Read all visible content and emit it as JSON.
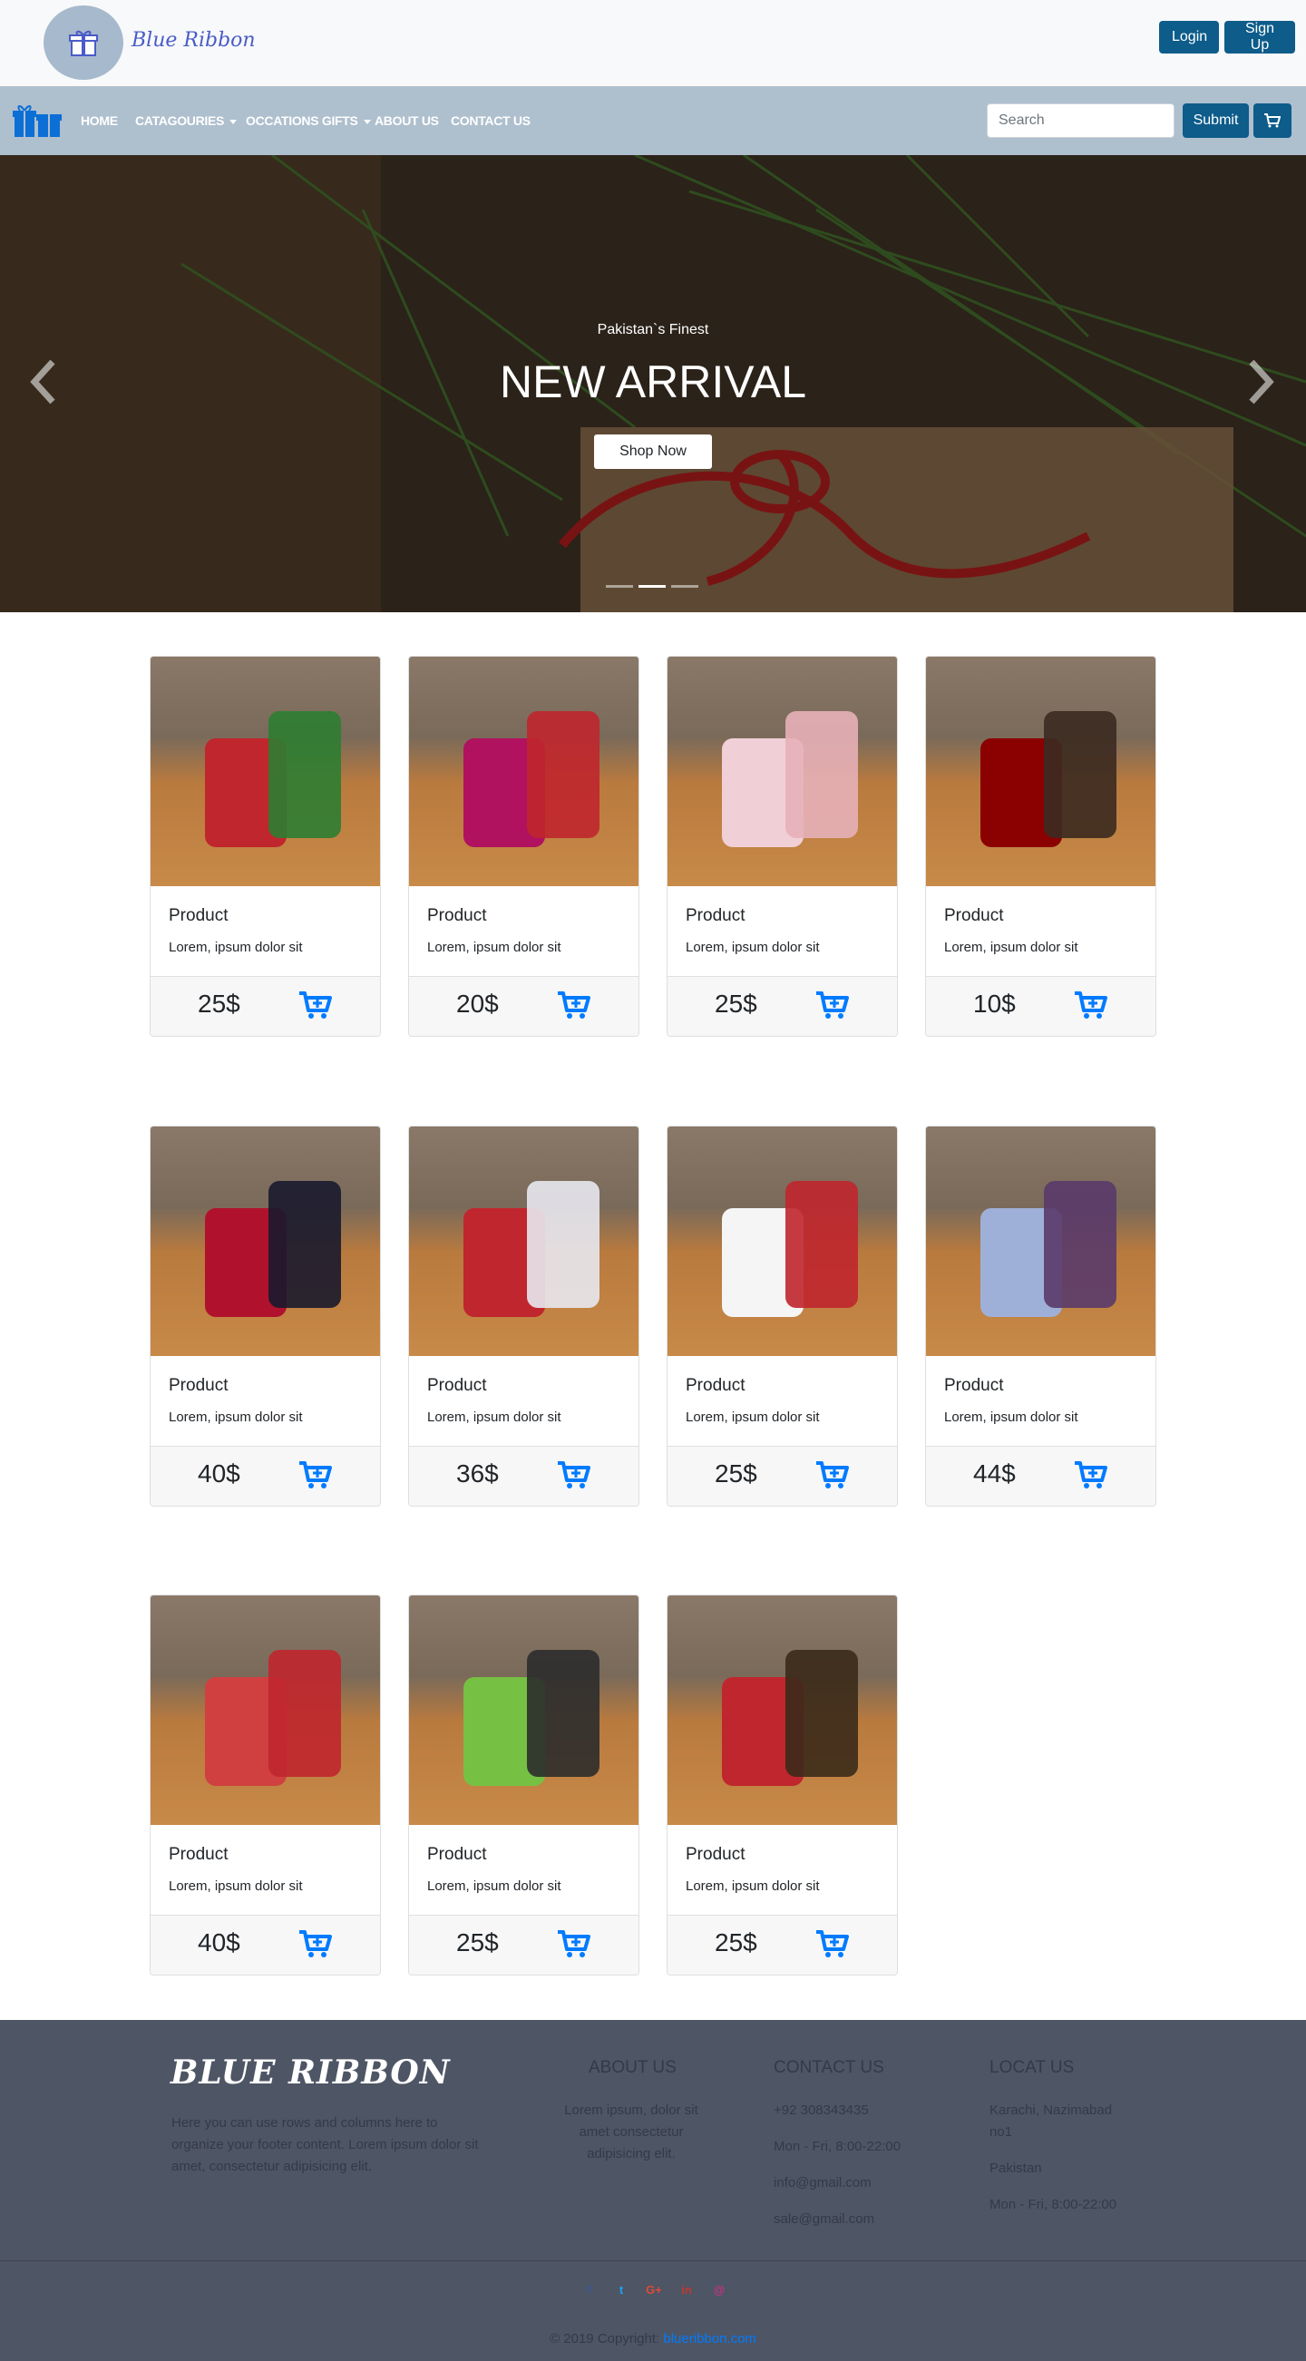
{
  "header": {
    "brand_name": "Blue Ribbon",
    "login_label": "Login",
    "signup_label": "Sign Up"
  },
  "nav": {
    "items": [
      {
        "label": "Home",
        "has_caret": false
      },
      {
        "label": "Catagouries",
        "has_caret": true
      },
      {
        "label": "Occations Gifts",
        "has_caret": true
      },
      {
        "label": "About Us",
        "has_caret": false
      },
      {
        "label": "Contact Us",
        "has_caret": false
      }
    ],
    "search_placeholder": "Search",
    "submit_label": "Submit",
    "cart_icon": "cart-icon"
  },
  "hero": {
    "kicker": "Pakistan`s Finest",
    "title": "NEW ARRIVAL",
    "button_label": "Shop Now",
    "slides": 3,
    "active_slide": 2
  },
  "products": [
    {
      "name": "Product",
      "desc": "Lorem, ipsum dolor sit",
      "price": "25$"
    },
    {
      "name": "Product",
      "desc": "Lorem, ipsum dolor sit",
      "price": "20$"
    },
    {
      "name": "Product",
      "desc": "Lorem, ipsum dolor sit",
      "price": "25$"
    },
    {
      "name": "Product",
      "desc": "Lorem, ipsum dolor sit",
      "price": "10$"
    },
    {
      "name": "Product",
      "desc": "Lorem, ipsum dolor sit",
      "price": "40$"
    },
    {
      "name": "Product",
      "desc": "Lorem, ipsum dolor sit",
      "price": "36$"
    },
    {
      "name": "Product",
      "desc": "Lorem, ipsum dolor sit",
      "price": "25$"
    },
    {
      "name": "Product",
      "desc": "Lorem, ipsum dolor sit",
      "price": "44$"
    },
    {
      "name": "Product",
      "desc": "Lorem, ipsum dolor sit",
      "price": "40$"
    },
    {
      "name": "Product",
      "desc": "Lorem, ipsum dolor sit",
      "price": "25$"
    },
    {
      "name": "Product",
      "desc": "Lorem, ipsum dolor sit",
      "price": "25$"
    }
  ],
  "footer": {
    "brand": "BLUE RIBBON",
    "about_text": "Here you can use rows and columns here to organize your footer content. Lorem ipsum dolor sit amet, consectetur adipisicing elit.",
    "about_heading": "ABOUT US",
    "about_body": "Lorem ipsum, dolor sit amet consectetur adipisicing elit.",
    "contact_heading": "CONTACT US",
    "contact_lines": [
      "+92 308343435",
      "Mon - Fri, 8:00-22:00",
      "info@gmail.com",
      "sale@gmail.com"
    ],
    "locate_heading": "LOCAT US",
    "locate_lines": [
      "Karachi, Nazimabad no1",
      "Pakistan",
      "Mon - Fri, 8:00-22:00"
    ],
    "socials": [
      "f",
      "t",
      "G+",
      "in",
      "@"
    ],
    "copyright_prefix": "© 2019 Copyright:",
    "copyright_link": "blueribbon.com"
  },
  "colors": {
    "primary_button": "#0d5c8a",
    "navbar": "#aebfce",
    "accent": "#007bff",
    "footer_bg": "#4e5565"
  }
}
